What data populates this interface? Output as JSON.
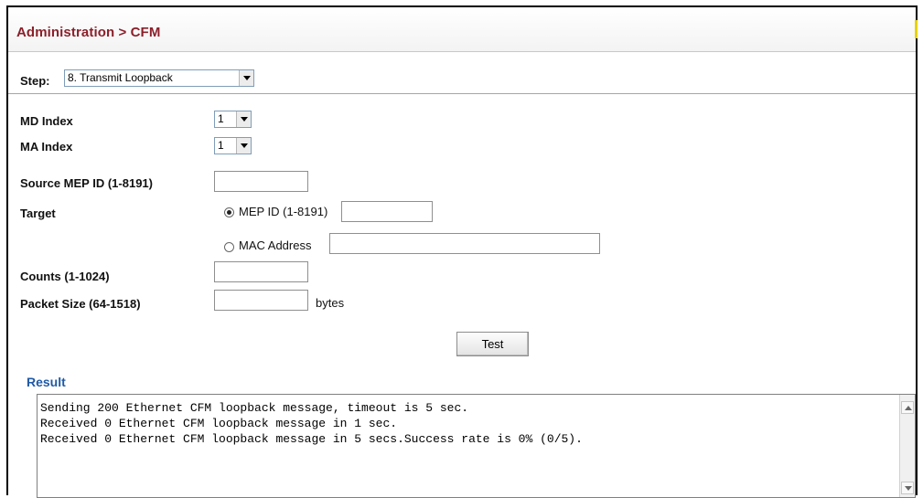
{
  "header": {
    "title": "Administration > CFM"
  },
  "step": {
    "label": "Step:",
    "selected": "8. Transmit Loopback"
  },
  "form": {
    "md_index_label": "MD Index",
    "md_index_value": "1",
    "ma_index_label": "MA Index",
    "ma_index_value": "1",
    "source_mep_label": "Source MEP ID (1-8191)",
    "target_label": "Target",
    "target_mep_label": "MEP ID (1-8191)",
    "target_mac_label": "MAC Address",
    "counts_label": "Counts (1-1024)",
    "packet_size_label": "Packet Size (64-1518)",
    "packet_size_unit": "bytes",
    "test_button": "Test"
  },
  "result": {
    "label": "Result",
    "lines": [
      "Sending 200 Ethernet CFM loopback message, timeout is 5 sec.",
      "Received 0 Ethernet CFM loopback message in 1 sec.",
      "Received 0 Ethernet CFM loopback message in 5 secs.Success rate is 0% (0/5)."
    ]
  },
  "colors": {
    "title": "#8b1f2a",
    "result_label": "#1f5aa6",
    "accent": "#e7d300"
  }
}
